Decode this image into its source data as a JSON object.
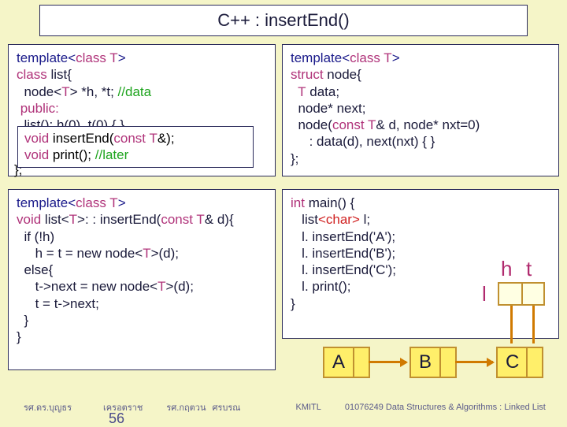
{
  "title": "C++  : insertEnd()",
  "box1": {
    "line1_a": "template<",
    "line1_b": "class",
    "line1_c": " T",
    "line1_d": ">",
    "line2_a": "class",
    "line2_b": " list{",
    "line3_a": "  node<",
    "line3_b": "T",
    "line3_c": "> *h, *t; ",
    "line3_d": "//data",
    "line4_a": " public:",
    "line5_a": "  list(): h(0), t(0) { }"
  },
  "box1_inner": {
    "line1_a": "void",
    "line1_b": " insertEnd(",
    "line1_c": "const",
    "line1_d": " T",
    "line1_e": "&);",
    "line2_a": "void",
    "line2_b": " print(); ",
    "line2_c": "//later"
  },
  "box1_close": "};",
  "box2": {
    "line1_a": "template<",
    "line1_b": "class",
    "line1_c": " T",
    "line1_d": ">",
    "line2_a": "struct",
    "line2_b": " node{",
    "line3_a": "  T",
    "line3_b": " data;",
    "line4_a": "  node* next;",
    "line5_a": "  node(",
    "line5_b": "const",
    "line5_c": " T",
    "line5_d": "& d, node* nxt=0)",
    "line6_a": "     : data(d), next(nxt) { }",
    "line7_a": "};"
  },
  "box3": {
    "line1_a": "template<",
    "line1_b": "class",
    "line1_c": " T",
    "line1_d": ">",
    "line2_a": "void",
    "line2_b": " list<",
    "line2_c": "T",
    "line2_d": ">: : insertEnd(",
    "line2_e": "const",
    "line2_f": " T",
    "line2_g": "& d){",
    "line3_a": "  if (!h)",
    "line4_a": "     h = t = new node<",
    "line4_b": "T",
    "line4_c": ">(d);",
    "line5_a": "  else{",
    "line6_a": "     t->next = new node<",
    "line6_b": "T",
    "line6_c": ">(d);",
    "line7_a": "     t = t->next;",
    "line8_a": "  }",
    "line9_a": "}"
  },
  "box4": {
    "line1_a": "int",
    "line1_b": " main() {",
    "line2_a": "   list",
    "line2_b": "<char>",
    "line2_c": " l;",
    "line3_a": "   l. insertEnd('A');",
    "line4_a": "   l. insertEnd('B');",
    "line5_a": "   l. insertEnd('C');",
    "line6_a": "   l. print();",
    "line7_a": "}"
  },
  "labels": {
    "h": "h",
    "t": "t",
    "l": "l"
  },
  "nodes": {
    "a": "A",
    "b": "B",
    "c": "C"
  },
  "footer": {
    "f1": "รศ.ดร.บุญธร",
    "f2": "เครอตราช",
    "f3": "รศ.กฤตวน",
    "f4": "ศรบรณ",
    "fk": "KMITL",
    "fc": "01076249 Data Structures & Algorithms  : Linked List"
  },
  "pagenum": "56"
}
